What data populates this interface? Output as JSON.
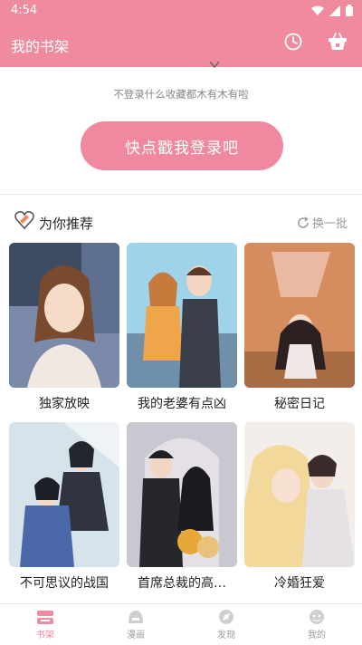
{
  "status": {
    "time": "4:54"
  },
  "header": {
    "title": "我的书架"
  },
  "login": {
    "hint": "不登录什么收藏都木有木有啦",
    "button_label": "快点戳我登录吧"
  },
  "recommend": {
    "title": "为你推荐",
    "refresh_label": "换一批"
  },
  "comics": [
    {
      "title": "独家放映"
    },
    {
      "title": "我的老婆有点凶"
    },
    {
      "title": "秘密日记"
    },
    {
      "title": "不可思议的战国"
    },
    {
      "title": "首席总裁的高…"
    },
    {
      "title": "冷婚狂爱"
    }
  ],
  "nav": [
    {
      "label": "书架",
      "icon": "bookshelf-icon",
      "active": true
    },
    {
      "label": "漫画",
      "icon": "comic-icon",
      "active": false
    },
    {
      "label": "发现",
      "icon": "discover-icon",
      "active": false
    },
    {
      "label": "我的",
      "icon": "profile-icon",
      "active": false
    }
  ],
  "colors": {
    "brand": "#ef8a9f",
    "button": "#f0899f"
  }
}
